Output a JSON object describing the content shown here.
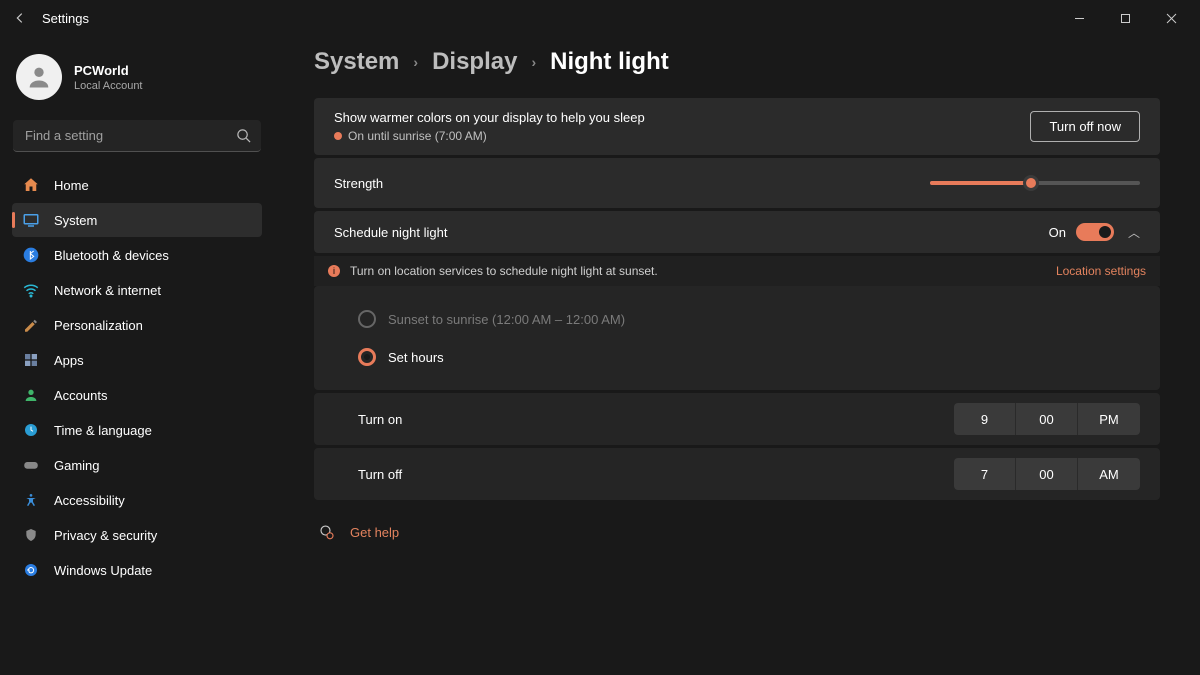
{
  "window": {
    "title": "Settings"
  },
  "account": {
    "name": "PCWorld",
    "sub": "Local Account"
  },
  "search": {
    "placeholder": "Find a setting"
  },
  "sidebar": {
    "items": [
      {
        "label": "Home"
      },
      {
        "label": "System"
      },
      {
        "label": "Bluetooth & devices"
      },
      {
        "label": "Network & internet"
      },
      {
        "label": "Personalization"
      },
      {
        "label": "Apps"
      },
      {
        "label": "Accounts"
      },
      {
        "label": "Time & language"
      },
      {
        "label": "Gaming"
      },
      {
        "label": "Accessibility"
      },
      {
        "label": "Privacy & security"
      },
      {
        "label": "Windows Update"
      }
    ]
  },
  "breadcrumb": {
    "a": "System",
    "b": "Display",
    "c": "Night light"
  },
  "hero": {
    "desc": "Show warmer colors on your display to help you sleep",
    "status": "On until sunrise (7:00 AM)",
    "button": "Turn off now"
  },
  "strength": {
    "label": "Strength",
    "percent": 48
  },
  "schedule": {
    "label": "Schedule night light",
    "state": "On",
    "info_text": "Turn on location services to schedule night light at sunset.",
    "info_link": "Location settings",
    "option_sunset": "Sunset to sunrise (12:00 AM – 12:00 AM)",
    "option_sethours": "Set hours",
    "turn_on_label": "Turn on",
    "turn_off_label": "Turn off",
    "on_time": {
      "h": "9",
      "m": "00",
      "ap": "PM"
    },
    "off_time": {
      "h": "7",
      "m": "00",
      "ap": "AM"
    }
  },
  "help": {
    "label": "Get help"
  },
  "colors": {
    "accent": "#e87b5a"
  }
}
